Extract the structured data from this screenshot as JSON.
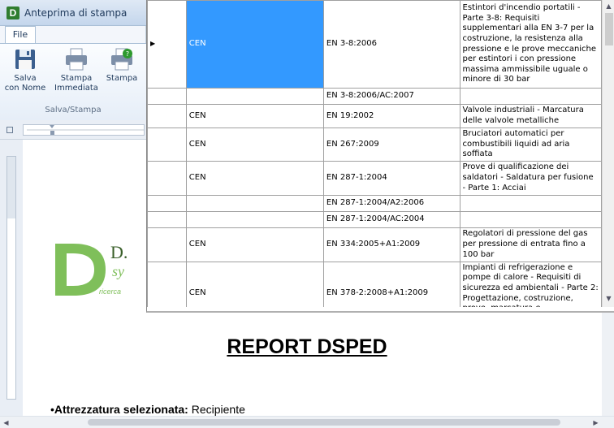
{
  "window": {
    "title": "Anteprima di stampa"
  },
  "ribbon": {
    "tab_file": "File",
    "buttons": [
      {
        "label": "Salva\ncon Nome",
        "icon": "floppy-disk-icon"
      },
      {
        "label": "Stampa\nImmediata",
        "icon": "printer-icon"
      },
      {
        "label": "Stampa",
        "icon": "printer-settings-icon"
      }
    ],
    "group_label": "Salva/Stampa"
  },
  "grid": {
    "rows": [
      {
        "org": "CEN",
        "code": "EN 3-8:2006",
        "desc": "Estintori d'incendio portatili - Parte 3-8: Requisiti supplementari alla EN 3-7 per la costruzione, la resistenza alla pressione e le prove meccaniche per estintori i con pressione massima ammissibile uguale o minore di 30 bar",
        "selected": true
      },
      {
        "org": "",
        "code": "EN 3-8:2006/AC:2007",
        "desc": ""
      },
      {
        "org": "CEN",
        "code": "EN 19:2002",
        "desc": "Valvole industriali - Marcatura delle valvole metalliche"
      },
      {
        "org": "CEN",
        "code": "EN 267:2009",
        "desc": "Bruciatori automatici per combustibili liquidi ad aria soffiata"
      },
      {
        "org": "CEN",
        "code": "EN 287-1:2004",
        "desc": "Prove di qualificazione dei saldatori - Saldatura per fusione - Parte 1: Acciai"
      },
      {
        "org": "",
        "code": "EN 287-1:2004/A2:2006",
        "desc": ""
      },
      {
        "org": "",
        "code": "EN 287-1:2004/AC:2004",
        "desc": ""
      },
      {
        "org": "CEN",
        "code": "EN 334:2005+A1:2009",
        "desc": "Regolatori di pressione del gas per pressione di entrata fino a 100 bar"
      },
      {
        "org": "CEN",
        "code": "EN 378-2:2008+A1:2009",
        "desc": "Impianti di refrigerazione e pompe di calore - Requisiti di sicurezza ed ambientali - Parte 2: Progettazione, costruzione, prove, marcatura e documentazione"
      }
    ]
  },
  "document": {
    "logo_text": "D.",
    "logo_sub": "sy",
    "logo_tag": "ricerca",
    "report_title": "REPORT DSPED",
    "attr_label": "Attrezzatura selezionata:",
    "attr_value": " Recipiente"
  }
}
